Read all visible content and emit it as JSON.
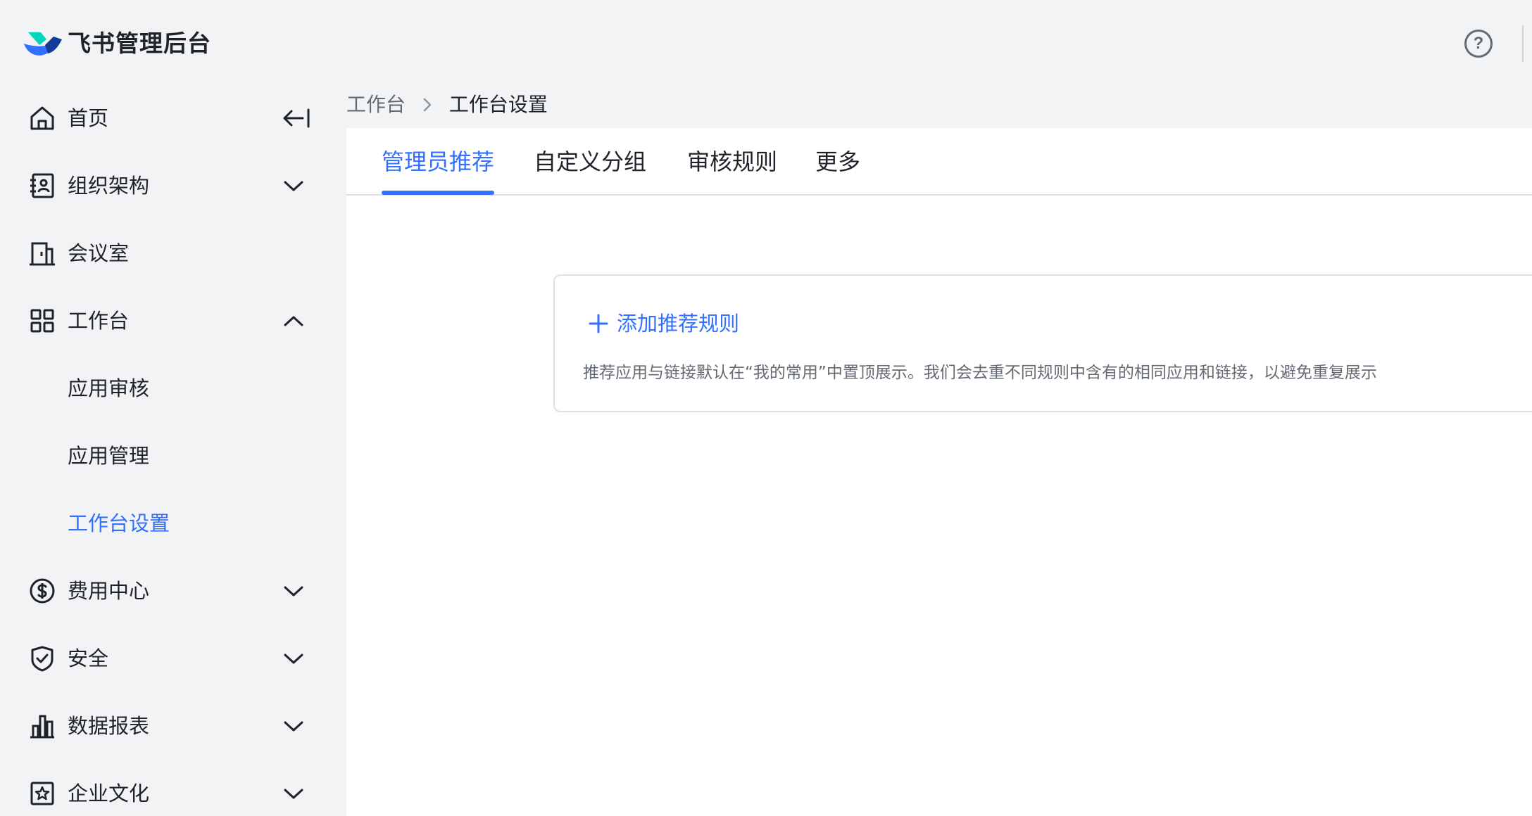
{
  "app": {
    "brand": "飞书管理后台",
    "brand_colors": {
      "primary": "#3370ff",
      "teal": "#00d6b9",
      "navy": "#133c9a"
    }
  },
  "topbar": {
    "help_icon": "question-circle-icon",
    "help_glyph": "?"
  },
  "sidebar": {
    "items": [
      {
        "label": "首页",
        "icon": "home-icon"
      },
      {
        "label": "组织架构",
        "icon": "contacts-icon"
      },
      {
        "label": "会议室",
        "icon": "meeting-room-icon"
      },
      {
        "label": "工作台",
        "icon": "grid-icon"
      },
      {
        "label": "应用审核"
      },
      {
        "label": "应用管理"
      },
      {
        "label": "工作台设置"
      },
      {
        "label": "费用中心",
        "icon": "dollar-circle-icon"
      },
      {
        "label": "安全",
        "icon": "shield-icon"
      },
      {
        "label": "数据报表",
        "icon": "bar-chart-icon"
      },
      {
        "label": "企业文化",
        "icon": "culture-icon"
      }
    ]
  },
  "breadcrumb": {
    "parent": "工作台",
    "current": "工作台设置"
  },
  "tabs": [
    "管理员推荐",
    "自定义分组",
    "审核规则",
    "更多"
  ],
  "card": {
    "add_label": "添加推荐规则",
    "description": "推荐应用与链接默认在“我的常用”中置顶展示。我们会去重不同规则中含有的相同应用和链接，以避免重复展示"
  },
  "colors": {
    "accent": "#3370ff",
    "text": "#1f2329",
    "secondary_text": "#646a73",
    "background": "#f2f3f5"
  }
}
